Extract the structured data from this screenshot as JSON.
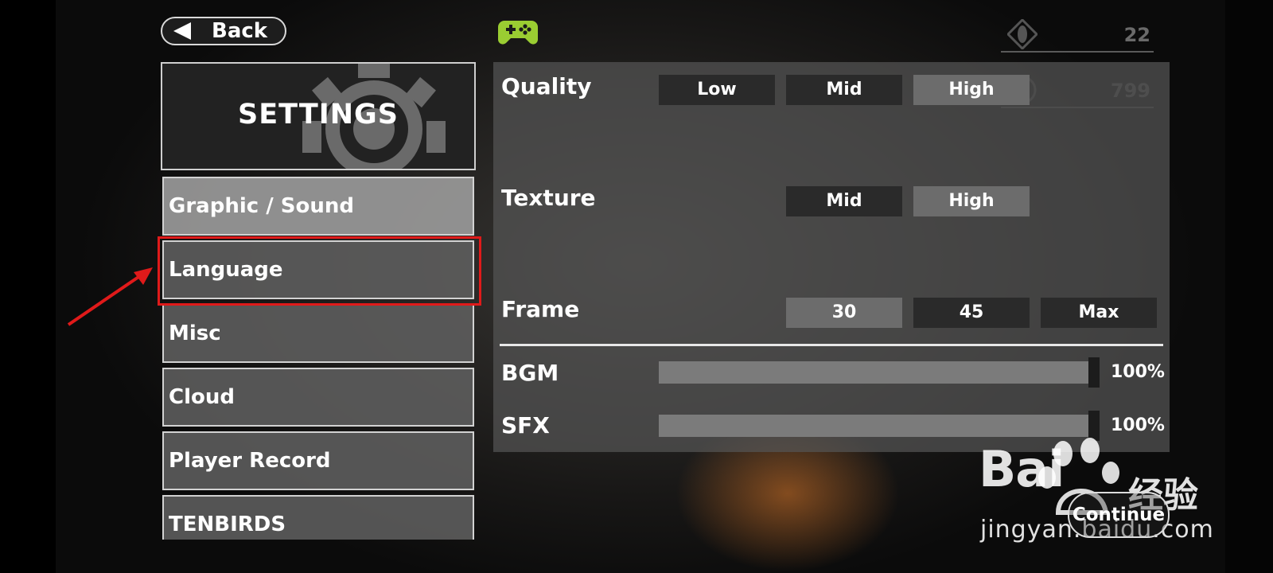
{
  "header": {
    "back_label": "Back",
    "gamepad_icon": "gamepad-icon",
    "resources": [
      {
        "icon": "crystal-icon",
        "value": "22"
      },
      {
        "icon": "coin-icon",
        "value": "799"
      }
    ]
  },
  "sidebar": {
    "title": "SETTINGS",
    "items": [
      {
        "label": "Graphic / Sound",
        "state": "active"
      },
      {
        "label": "Language",
        "state": "highlighted"
      },
      {
        "label": "Misc"
      },
      {
        "label": "Cloud"
      },
      {
        "label": "Player Record"
      },
      {
        "label": "TENBIRDS"
      }
    ]
  },
  "settings": {
    "quality": {
      "label": "Quality",
      "options": [
        "Low",
        "Mid",
        "High"
      ],
      "selected": "High"
    },
    "texture": {
      "label": "Texture",
      "options": [
        "Mid",
        "High"
      ],
      "selected": "High"
    },
    "frame": {
      "label": "Frame",
      "options": [
        "30",
        "45",
        "Max"
      ],
      "selected": "30"
    },
    "bgm": {
      "label": "BGM",
      "value": 100,
      "display": "100%"
    },
    "sfx": {
      "label": "SFX",
      "value": 100,
      "display": "100%"
    }
  },
  "footer": {
    "continue_label": "Continue"
  },
  "watermark": {
    "logo": "Bai",
    "cn": "经验",
    "url": "jingyan.baidu.com"
  },
  "colors": {
    "highlight": "#e01a1a",
    "gamepad": "#9acd32"
  }
}
